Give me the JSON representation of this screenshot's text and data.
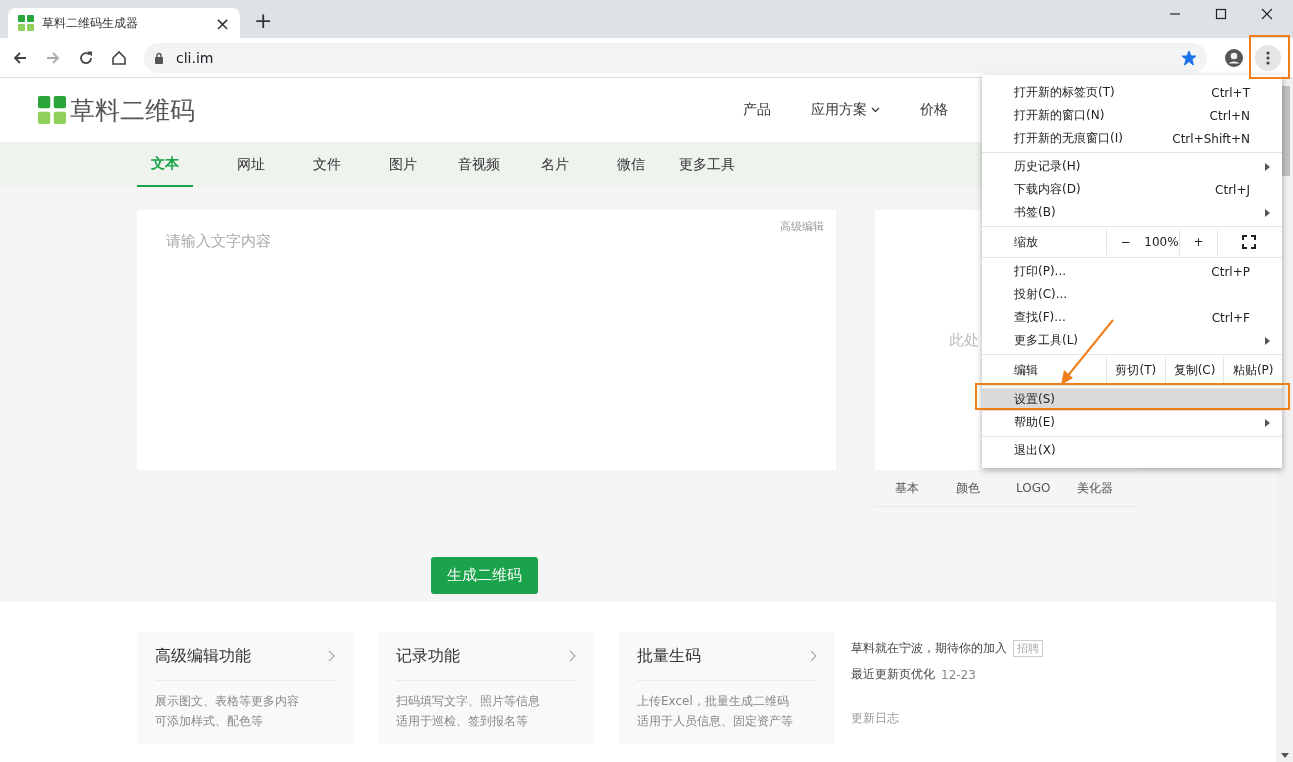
{
  "browser": {
    "tab": {
      "title": "草料二维码生成器",
      "close": "×"
    },
    "new_tab": "+",
    "url": "cli.im",
    "bookmarked": true
  },
  "site": {
    "logo": "草料二维码",
    "nav": [
      {
        "label": "产品",
        "dropdown": false
      },
      {
        "label": "应用方案",
        "dropdown": true
      },
      {
        "label": "价格",
        "dropdown": false
      }
    ],
    "tabs": [
      {
        "label": "文本",
        "selected": true
      },
      {
        "label": "网址",
        "selected": false
      },
      {
        "label": "文件",
        "selected": false
      },
      {
        "label": "图片",
        "selected": false
      },
      {
        "label": "音视频",
        "selected": false
      },
      {
        "label": "名片",
        "selected": false
      },
      {
        "label": "微信",
        "selected": false
      },
      {
        "label": "更多工具",
        "selected": false
      }
    ],
    "editor": {
      "placeholder": "请输入文字内容",
      "advanced_link": "高级编辑"
    },
    "preview": {
      "hint": "此处",
      "tabs": [
        "基本",
        "颜色",
        "LOGO",
        "美化器"
      ]
    },
    "generate_button": "生成二维码",
    "features": [
      {
        "title": "高级编辑功能",
        "lines": [
          "展示图文、表格等更多内容",
          "可添加样式、配色等"
        ]
      },
      {
        "title": "记录功能",
        "lines": [
          "扫码填写文字、照片等信息",
          "适用于巡检、签到报名等"
        ]
      },
      {
        "title": "批量生码",
        "lines": [
          "上传Excel，批量生成二维码",
          "适用于人员信息、固定资产等"
        ]
      }
    ],
    "news": {
      "recruit": "草料就在宁波，期待你的加入",
      "recruit_tag": "招聘",
      "update": "最近更新页优化",
      "update_date": "12-23",
      "changelog": "更新日志"
    }
  },
  "menu": {
    "groups": [
      [
        {
          "kind": "item",
          "label": "打开新的标签页(T)",
          "shortcut": "Ctrl+T",
          "submenu": false,
          "selected": false
        },
        {
          "kind": "item",
          "label": "打开新的窗口(N)",
          "shortcut": "Ctrl+N",
          "submenu": false,
          "selected": false
        },
        {
          "kind": "item",
          "label": "打开新的无痕窗口(I)",
          "shortcut": "Ctrl+Shift+N",
          "submenu": false,
          "selected": false
        }
      ],
      [
        {
          "kind": "item",
          "label": "历史记录(H)",
          "submenu": true,
          "selected": false
        },
        {
          "kind": "item",
          "label": "下载内容(D)",
          "shortcut": "Ctrl+J",
          "submenu": false,
          "selected": false
        },
        {
          "kind": "item",
          "label": "书签(B)",
          "submenu": true,
          "selected": false
        }
      ],
      [
        {
          "kind": "zoom",
          "label": "缩放",
          "minus": "−",
          "value": "100%",
          "plus": "+"
        }
      ],
      [
        {
          "kind": "item",
          "label": "打印(P)...",
          "shortcut": "Ctrl+P",
          "submenu": false,
          "selected": false
        },
        {
          "kind": "item",
          "label": "投射(C)...",
          "submenu": false,
          "selected": false
        },
        {
          "kind": "item",
          "label": "查找(F)...",
          "shortcut": "Ctrl+F",
          "submenu": false,
          "selected": false
        },
        {
          "kind": "item",
          "label": "更多工具(L)",
          "submenu": true,
          "selected": false
        }
      ],
      [
        {
          "kind": "edit",
          "label": "编辑",
          "actions": [
            "剪切(T)",
            "复制(C)",
            "粘贴(P)"
          ]
        }
      ],
      [
        {
          "kind": "item",
          "label": "设置(S)",
          "submenu": false,
          "selected": true
        },
        {
          "kind": "item",
          "label": "帮助(E)",
          "submenu": true,
          "selected": false
        }
      ],
      [
        {
          "kind": "item",
          "label": "退出(X)",
          "submenu": false,
          "selected": false
        }
      ]
    ]
  }
}
